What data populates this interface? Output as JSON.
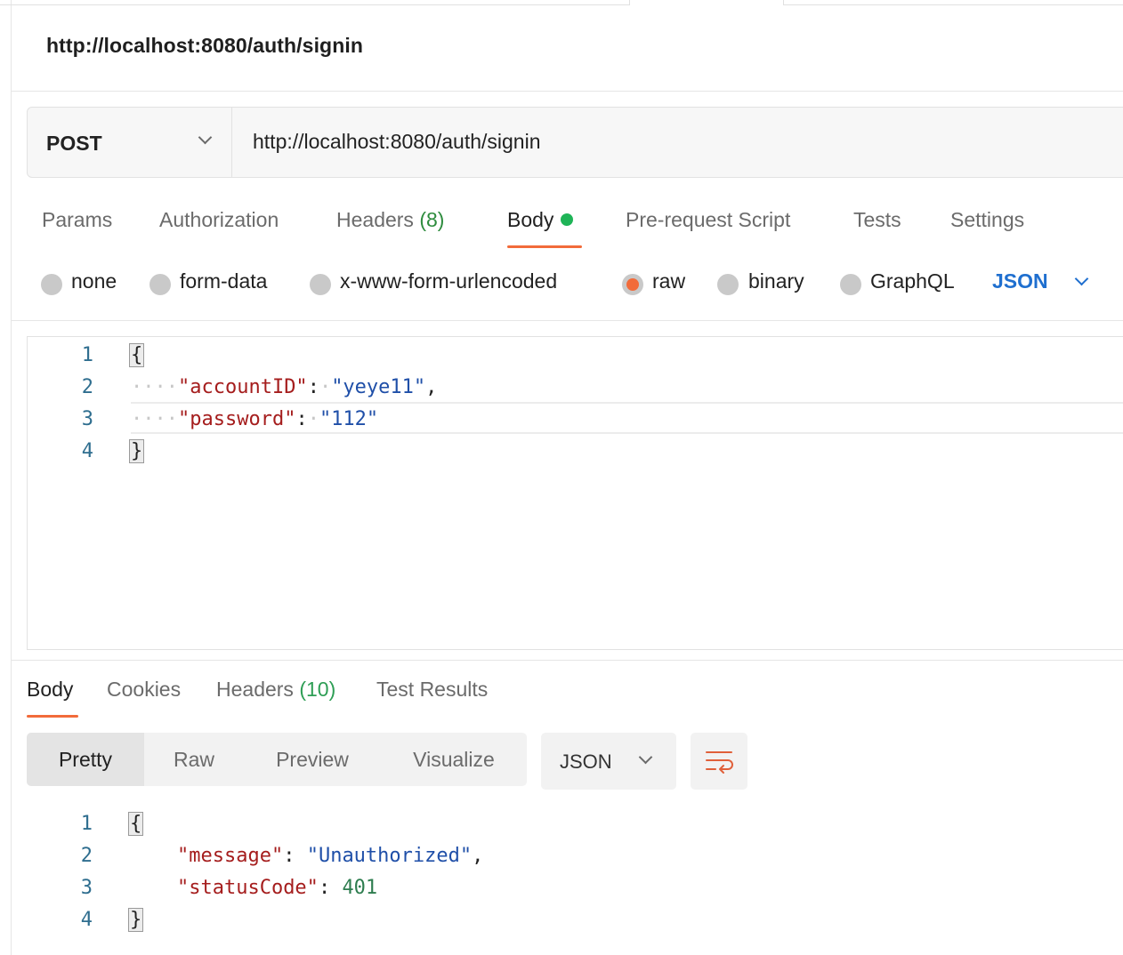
{
  "request": {
    "title": "http://localhost:8080/auth/signin",
    "method": "POST",
    "url": "http://localhost:8080/auth/signin"
  },
  "request_tabs": {
    "params": "Params",
    "authorization": "Authorization",
    "headers": "Headers",
    "headers_count": "(8)",
    "body": "Body",
    "prerequest": "Pre-request Script",
    "tests": "Tests",
    "settings": "Settings"
  },
  "body_modes": {
    "none": "none",
    "form_data": "form-data",
    "urlencoded": "x-www-form-urlencoded",
    "raw": "raw",
    "binary": "binary",
    "graphql": "GraphQL",
    "language": "JSON",
    "selected": "raw"
  },
  "request_body": {
    "line_numbers": [
      "1",
      "2",
      "3",
      "4"
    ],
    "open_brace": "{",
    "close_brace": "}",
    "key1": "\"accountID\"",
    "val1": "\"yeye11\"",
    "key2": "\"password\"",
    "val2": "\"112\""
  },
  "response_tabs": {
    "body": "Body",
    "cookies": "Cookies",
    "headers": "Headers",
    "headers_count": "(10)",
    "test_results": "Test Results"
  },
  "response_view": {
    "pretty": "Pretty",
    "raw": "Raw",
    "preview": "Preview",
    "visualize": "Visualize",
    "language": "JSON"
  },
  "response_body": {
    "line_numbers": [
      "1",
      "2",
      "3",
      "4"
    ],
    "open_brace": "{",
    "close_brace": "}",
    "key1": "\"message\"",
    "val1": "\"Unauthorized\"",
    "key2": "\"statusCode\"",
    "val2": "401"
  },
  "colors": {
    "accent": "#f26b3a",
    "link_blue": "#1f6fcf",
    "success_green": "#1fb457"
  },
  "icons": {
    "method_dropdown": "chevron-down-icon",
    "wrap": "text-wrap-icon",
    "body_indicator": "green-dot-icon"
  }
}
